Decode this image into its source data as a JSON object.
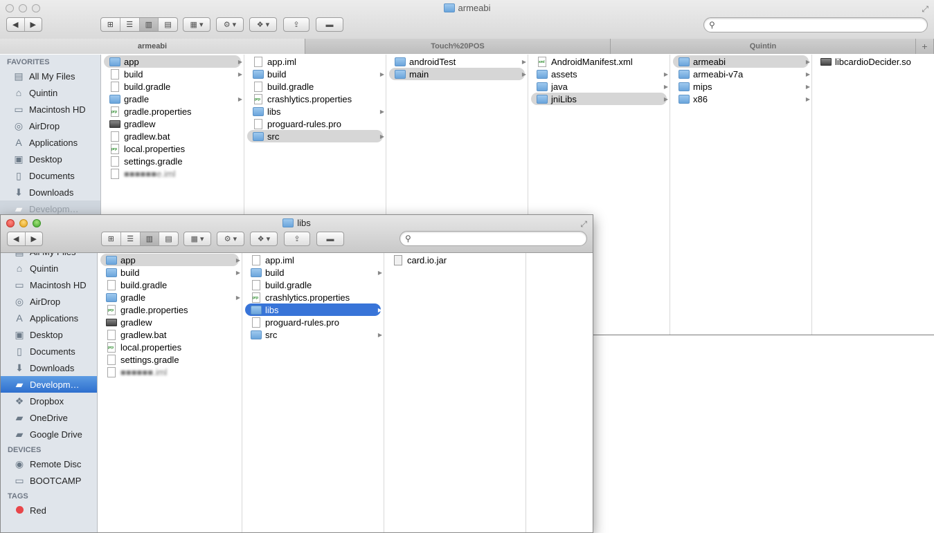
{
  "back_window": {
    "title": "armeabi",
    "tabs": [
      "armeabi",
      "Touch%20POS",
      "Quintin",
      "+"
    ],
    "search_placeholder": "",
    "sidebar": {
      "favorites_header": "FAVORITES",
      "items": [
        {
          "label": "All My Files",
          "icon": "all-files-icon"
        },
        {
          "label": "Quintin",
          "icon": "home-icon"
        },
        {
          "label": "Macintosh HD",
          "icon": "disk-icon"
        },
        {
          "label": "AirDrop",
          "icon": "airdrop-icon"
        },
        {
          "label": "Applications",
          "icon": "applications-icon"
        },
        {
          "label": "Desktop",
          "icon": "desktop-icon"
        },
        {
          "label": "Documents",
          "icon": "documents-icon"
        },
        {
          "label": "Downloads",
          "icon": "downloads-icon"
        },
        {
          "label": "Developm…",
          "icon": "folder-icon"
        }
      ]
    },
    "columns": [
      [
        {
          "name": "app",
          "kind": "folder",
          "state": "hl",
          "arrow": true
        },
        {
          "name": "build",
          "kind": "doc",
          "arrow": true
        },
        {
          "name": "build.gradle",
          "kind": "doc"
        },
        {
          "name": "gradle",
          "kind": "folder",
          "arrow": true
        },
        {
          "name": "gradle.properties",
          "kind": "prop"
        },
        {
          "name": "gradlew",
          "kind": "exec"
        },
        {
          "name": "gradlew.bat",
          "kind": "doc"
        },
        {
          "name": "local.properties",
          "kind": "prop"
        },
        {
          "name": "settings.gradle",
          "kind": "doc"
        },
        {
          "name": "■■■■■■e.iml",
          "kind": "doc",
          "blur": true
        }
      ],
      [
        {
          "name": "app.iml",
          "kind": "doc"
        },
        {
          "name": "build",
          "kind": "folder",
          "arrow": true
        },
        {
          "name": "build.gradle",
          "kind": "doc"
        },
        {
          "name": "crashlytics.properties",
          "kind": "prop"
        },
        {
          "name": "libs",
          "kind": "folder",
          "arrow": true
        },
        {
          "name": "proguard-rules.pro",
          "kind": "doc"
        },
        {
          "name": "src",
          "kind": "folder",
          "state": "hl",
          "arrow": true
        }
      ],
      [
        {
          "name": "androidTest",
          "kind": "folder",
          "arrow": true
        },
        {
          "name": "main",
          "kind": "folder",
          "state": "hl",
          "arrow": true
        }
      ],
      [
        {
          "name": "AndroidManifest.xml",
          "kind": "xml"
        },
        {
          "name": "assets",
          "kind": "folder",
          "arrow": true
        },
        {
          "name": "java",
          "kind": "folder",
          "arrow": true
        },
        {
          "name": "jniLibs",
          "kind": "folder",
          "state": "hl",
          "arrow": true
        }
      ],
      [
        {
          "name": "armeabi",
          "kind": "folder",
          "state": "hl",
          "arrow": true
        },
        {
          "name": "armeabi-v7a",
          "kind": "folder",
          "arrow": true
        },
        {
          "name": "mips",
          "kind": "folder",
          "arrow": true
        },
        {
          "name": "x86",
          "kind": "folder",
          "arrow": true
        }
      ],
      [
        {
          "name": "libcardioDecider.so",
          "kind": "exec"
        }
      ]
    ]
  },
  "front_window": {
    "title": "libs",
    "search_placeholder": "",
    "sidebar": {
      "items": [
        {
          "label": "All My Files",
          "icon": "all-files-icon"
        },
        {
          "label": "Quintin",
          "icon": "home-icon"
        },
        {
          "label": "Macintosh HD",
          "icon": "disk-icon"
        },
        {
          "label": "AirDrop",
          "icon": "airdrop-icon"
        },
        {
          "label": "Applications",
          "icon": "applications-icon"
        },
        {
          "label": "Desktop",
          "icon": "desktop-icon"
        },
        {
          "label": "Documents",
          "icon": "documents-icon"
        },
        {
          "label": "Downloads",
          "icon": "downloads-icon"
        },
        {
          "label": "Developm…",
          "icon": "folder-icon",
          "selected": true
        },
        {
          "label": "Dropbox",
          "icon": "dropbox-icon"
        },
        {
          "label": "OneDrive",
          "icon": "folder-icon"
        },
        {
          "label": "Google Drive",
          "icon": "folder-icon"
        }
      ],
      "devices_header": "DEVICES",
      "devices": [
        {
          "label": "Remote Disc",
          "icon": "remote-disc-icon"
        },
        {
          "label": "BOOTCAMP",
          "icon": "disk-icon"
        }
      ],
      "tags_header": "TAGS",
      "tags": [
        {
          "label": "Red",
          "color": "#e8464a"
        }
      ]
    },
    "columns": [
      [
        {
          "name": "app",
          "kind": "folder",
          "state": "hl",
          "arrow": true
        },
        {
          "name": "build",
          "kind": "folder",
          "arrow": true
        },
        {
          "name": "build.gradle",
          "kind": "doc"
        },
        {
          "name": "gradle",
          "kind": "folder",
          "arrow": true
        },
        {
          "name": "gradle.properties",
          "kind": "prop"
        },
        {
          "name": "gradlew",
          "kind": "exec"
        },
        {
          "name": "gradlew.bat",
          "kind": "doc"
        },
        {
          "name": "local.properties",
          "kind": "prop"
        },
        {
          "name": "settings.gradle",
          "kind": "doc"
        },
        {
          "name": "■■■■■■.iml",
          "kind": "doc",
          "blur": true
        }
      ],
      [
        {
          "name": "app.iml",
          "kind": "doc"
        },
        {
          "name": "build",
          "kind": "folder",
          "arrow": true
        },
        {
          "name": "build.gradle",
          "kind": "doc"
        },
        {
          "name": "crashlytics.properties",
          "kind": "prop"
        },
        {
          "name": "libs",
          "kind": "folder",
          "state": "sel",
          "arrow": true
        },
        {
          "name": "proguard-rules.pro",
          "kind": "doc"
        },
        {
          "name": "src",
          "kind": "folder",
          "arrow": true
        }
      ],
      [
        {
          "name": "card.io.jar",
          "kind": "jar"
        }
      ],
      []
    ]
  },
  "colors": {
    "selection_blue": "#3874d8",
    "sidebar_bg": "#e0e5eb",
    "highlight_gray": "#d6d6d6"
  }
}
